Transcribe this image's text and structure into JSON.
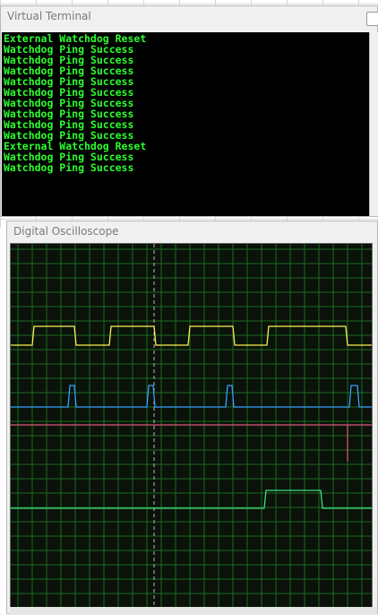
{
  "terminal": {
    "title": "Virtual Terminal",
    "lines": [
      "External Watchdog Reset",
      "Watchdog Ping Success",
      "Watchdog Ping Success",
      "Watchdog Ping Success",
      "Watchdog Ping Success",
      "Watchdog Ping Success",
      "Watchdog Ping Success",
      "Watchdog Ping Success",
      "Watchdog Ping Success",
      "Watchdog Ping Success",
      "External Watchdog Reset",
      "Watchdog Ping Success",
      "Watchdog Ping Success"
    ],
    "text_color": "#2cff2c",
    "background_color": "#000000"
  },
  "oscilloscope": {
    "title": "Digital Oscilloscope",
    "grid_color": "#1f6a1f",
    "trace_colors": {
      "channel_a": "#ffee55",
      "channel_b": "#3aa0ff",
      "channel_c": "#e05a78",
      "channel_d": "#3ddc84"
    }
  }
}
